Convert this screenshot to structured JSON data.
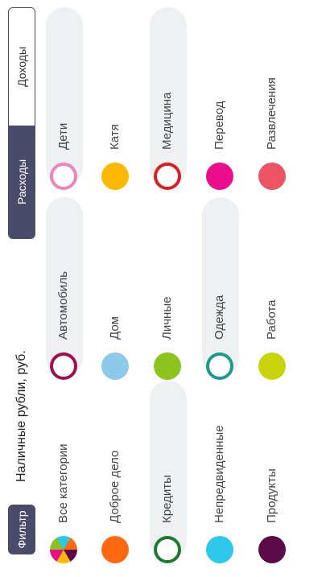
{
  "filter_button": "Фильтр",
  "account_label": "Наличные рубли, руб.",
  "tabs": {
    "expenses": "Расходы",
    "income": "Доходы"
  },
  "categories": [
    {
      "id": "all",
      "label": "Все категории",
      "color": "multicolor"
    },
    {
      "id": "charity",
      "label": "Доброе дело",
      "color": "#ff6a10"
    },
    {
      "id": "credits",
      "label": "Кредиты",
      "color": "#1e7a32",
      "selected": true
    },
    {
      "id": "unforeseen",
      "label": "Непредвиденные",
      "color": "#2ec8ea"
    },
    {
      "id": "products",
      "label": "Продукты",
      "color": "#5b0b4a"
    },
    {
      "id": "car",
      "label": "Автомобиль",
      "color": "#a0104f",
      "selected": true
    },
    {
      "id": "home",
      "label": "Дом",
      "color": "#8cc9ea"
    },
    {
      "id": "personal",
      "label": "Личные",
      "color": "#8bc21c"
    },
    {
      "id": "clothes",
      "label": "Одежда",
      "color": "#1d9a8a",
      "selected": true
    },
    {
      "id": "work",
      "label": "Работа",
      "color": "#c9d40b"
    },
    {
      "id": "kids",
      "label": "Дети",
      "color": "#ee84c2",
      "selected": true
    },
    {
      "id": "katya",
      "label": "Катя",
      "color": "#ffb800"
    },
    {
      "id": "medicine",
      "label": "Медицина",
      "color": "#d81f26",
      "selected": true
    },
    {
      "id": "transfer",
      "label": "Перевод",
      "color": "#ec0d8c"
    },
    {
      "id": "entertainment",
      "label": "Развлечения",
      "color": "#ee5363"
    }
  ]
}
